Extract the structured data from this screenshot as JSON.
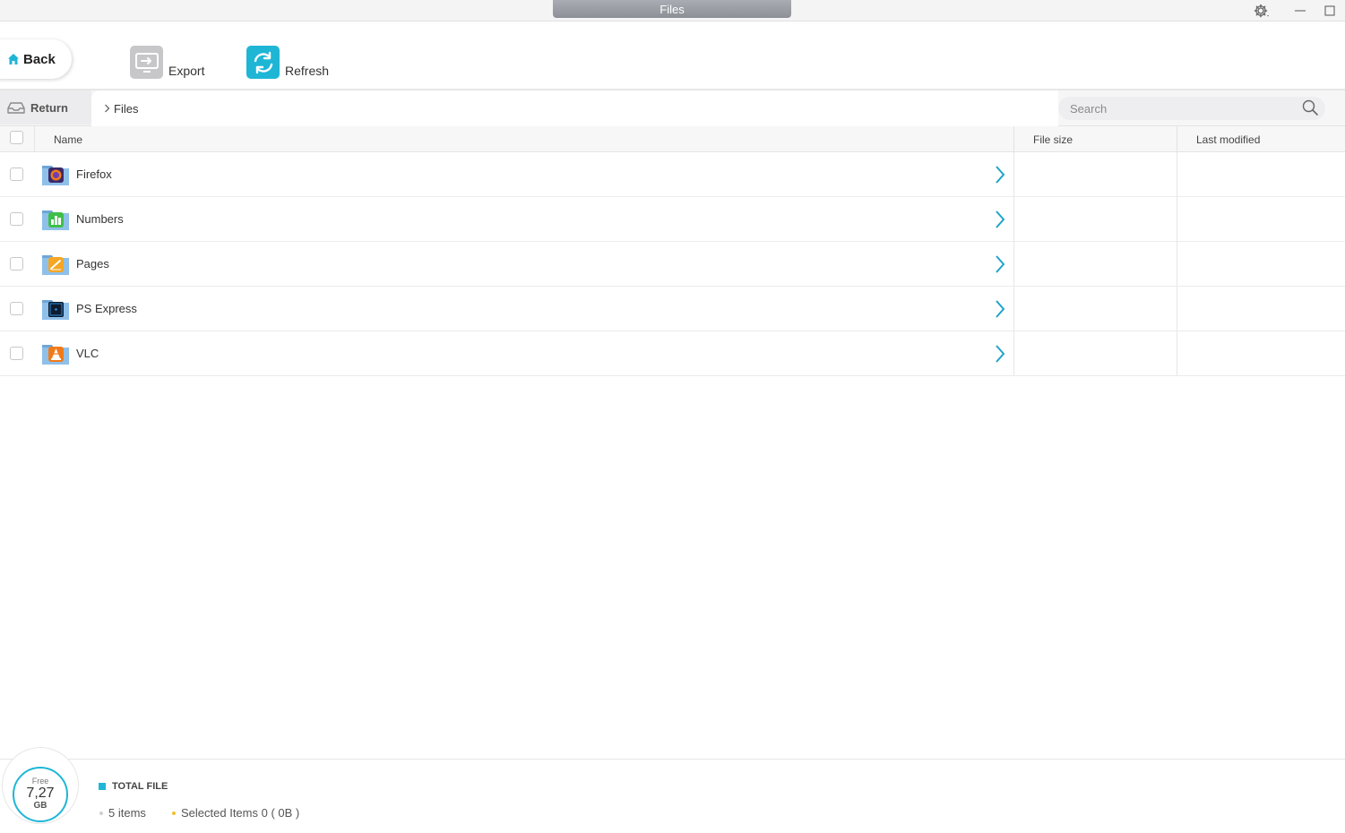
{
  "window": {
    "title": "Files",
    "icons": [
      "gear-icon",
      "minimize-icon",
      "maximize-icon"
    ]
  },
  "toolbar": {
    "back_label": "Back",
    "export_label": "Export",
    "refresh_label": "Refresh",
    "accent": "#1fb6d6"
  },
  "breadcrumb": {
    "return_label": "Return",
    "path": [
      "Files"
    ]
  },
  "search": {
    "placeholder": "Search",
    "value": ""
  },
  "table": {
    "columns": {
      "name": "Name",
      "size": "File size",
      "modified": "Last modified"
    },
    "rows": [
      {
        "name": "Firefox",
        "icon": "firefox-app-icon",
        "size": "",
        "modified": ""
      },
      {
        "name": "Numbers",
        "icon": "numbers-app-icon",
        "size": "",
        "modified": ""
      },
      {
        "name": "Pages",
        "icon": "pages-app-icon",
        "size": "",
        "modified": ""
      },
      {
        "name": "PS Express",
        "icon": "ps-express-app-icon",
        "size": "",
        "modified": ""
      },
      {
        "name": "VLC",
        "icon": "vlc-app-icon",
        "size": "",
        "modified": ""
      }
    ]
  },
  "footer": {
    "free_label": "Free",
    "free_value": "7,27",
    "free_unit": "GB",
    "total_label": "TOTAL FILE",
    "items_text": "5 items",
    "selected_text": "Selected Items 0 ( 0B )",
    "colors": {
      "total": "#1fb6d6",
      "items_dot": "#cfcfcf",
      "selected_dot": "#f2c12e"
    }
  }
}
